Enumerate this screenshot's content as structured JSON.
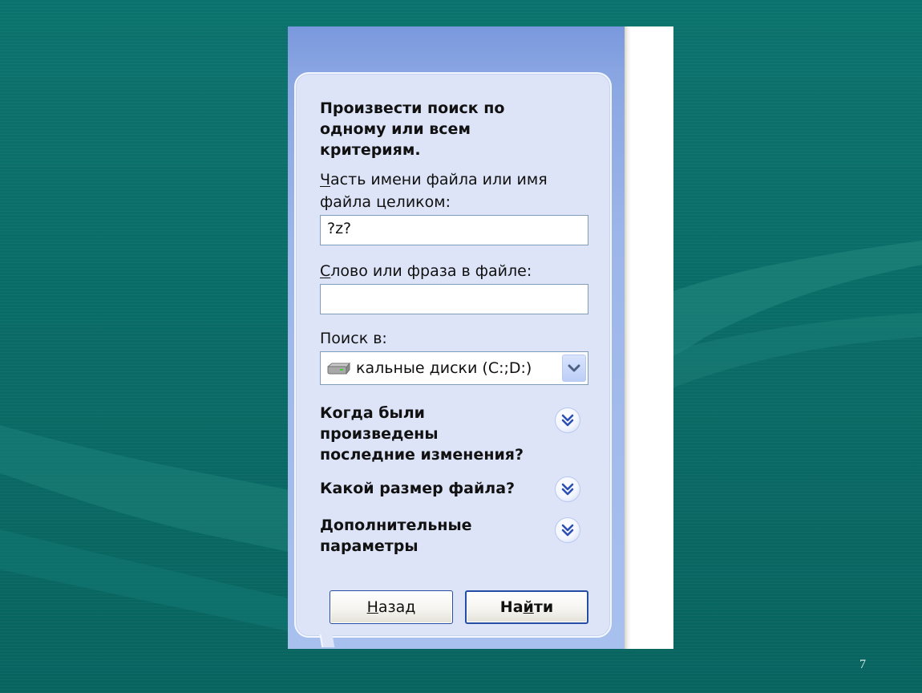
{
  "slide": {
    "number": "7"
  },
  "search_panel": {
    "heading": "Произвести поиск по\nодному или всем\nкритериям.",
    "filename": {
      "label_underlined": "Ч",
      "label_rest": "асть имени файла или имя\nфайла целиком:",
      "value": "?z?"
    },
    "phrase": {
      "label_underlined": "С",
      "label_rest": "лово или фраза в файле:",
      "value": ""
    },
    "location": {
      "label": "Поиск в:",
      "selected": "кальные диски (C:;D:)",
      "icon": "drive-icon"
    },
    "sections": [
      {
        "label": "Когда были\nпроизведены\nпоследние изменения?",
        "icon": "expand-down-icon"
      },
      {
        "label": "Какой размер файла?",
        "icon": "expand-down-icon"
      },
      {
        "label": "Дополнительные\nпараметры",
        "icon": "expand-down-icon"
      }
    ],
    "buttons": {
      "back_underlined": "Н",
      "back_rest": "азад",
      "find_prefix": "На",
      "find_underlined": "й",
      "find_rest": "ти"
    }
  },
  "colors": {
    "slide_background": "#0b6d68",
    "pane_blue": "#8aa6e2",
    "bubble_fill": "#dde4f7",
    "button_border": "#254da3"
  }
}
